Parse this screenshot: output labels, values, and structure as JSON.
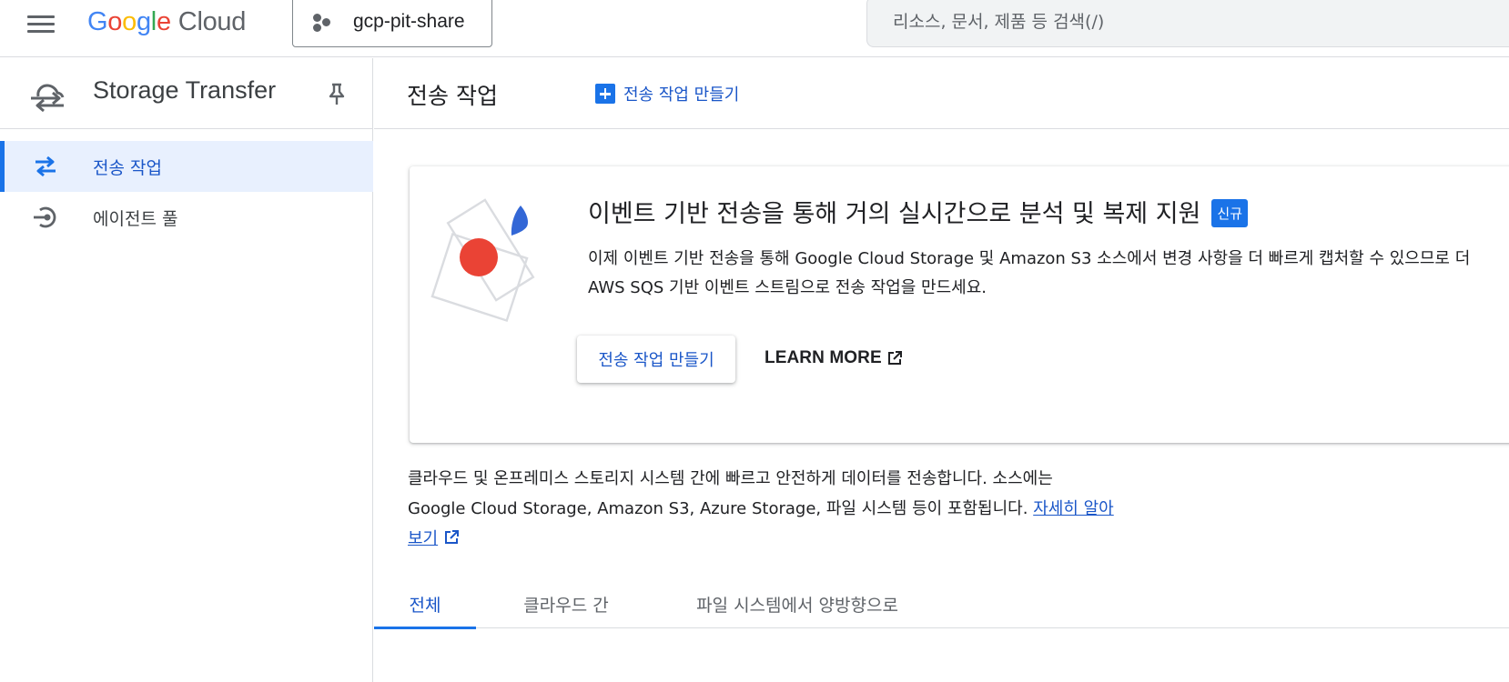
{
  "header": {
    "logo": {
      "letters": [
        "G",
        "o",
        "o",
        "g",
        "l",
        "e"
      ],
      "letter_colors": [
        "#4285f4",
        "#ea4335",
        "#fbbc04",
        "#4285f4",
        "#34a853",
        "#ea4335"
      ],
      "product": "Cloud"
    },
    "project_name": "gcp-pit-share",
    "search_placeholder": "리소스, 문서, 제품 등 검색(/)"
  },
  "sidebar": {
    "title": "Storage Transfer",
    "items": [
      {
        "label": "전송 작업",
        "icon": "transfer-arrows-icon",
        "active": true
      },
      {
        "label": "에이전트 풀",
        "icon": "agent-pool-icon",
        "active": false
      }
    ]
  },
  "main": {
    "title": "전송 작업",
    "create_label": "전송 작업 만들기",
    "banner": {
      "title": "이벤트 기반 전송을 통해 거의 실시간으로 분석 및 복제 지원",
      "badge": "신규",
      "desc_line1": "이제 이벤트 기반 전송을 통해 Google Cloud Storage 및 Amazon S3 소스에서 변경 사항을 더 빠르게 캡처할 수 있으므로 더",
      "desc_line2": "AWS SQS 기반 이벤트 스트림으로 전송 작업을 만드세요.",
      "create_button": "전송 작업 만들기",
      "learn_more": "LEARN MORE"
    },
    "intro": {
      "line1": "클라우드 및 온프레미스 스토리지 시스템 간에 빠르고 안전하게 데이터를 전송합니다. 소스에는",
      "line2": "Google Cloud Storage, Amazon S3, Azure Storage, 파일 시스템 등이 포함됩니다.",
      "link_part1": "자세히 알아",
      "link_part2": "보기"
    },
    "tabs": [
      {
        "label": "전체",
        "active": true
      },
      {
        "label": "클라우드 간",
        "active": false
      },
      {
        "label": "파일 시스템에서 양방향으로",
        "active": false
      }
    ]
  },
  "colors": {
    "accent": "#1a73e8",
    "link": "#1a56c8",
    "active_nav_bg": "#e8f0fe",
    "illustration_red": "#ea4335",
    "illustration_blue": "#3367d6"
  }
}
